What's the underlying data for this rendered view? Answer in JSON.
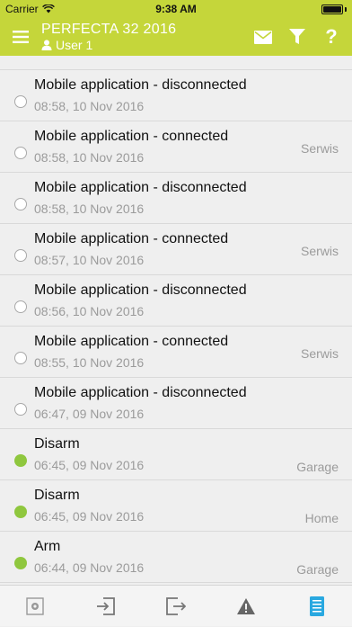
{
  "status_bar": {
    "carrier": "Carrier",
    "time": "9:38 AM"
  },
  "header": {
    "title": "PERFECTA 32 2016",
    "user": "User 1",
    "icons": {
      "menu": "menu-icon",
      "mail": "mail-icon",
      "filter": "filter-icon",
      "help": "help-icon"
    },
    "help_glyph": "?"
  },
  "colors": {
    "brand": "#c5d63a",
    "active_dot": "#8fc73e",
    "inactive_dot": "#ffffff",
    "tab_active": "#29a8e0"
  },
  "events": [
    {
      "title": "Mobile application - disconnected",
      "date": "08:58, 10 Nov 2016",
      "tag": "",
      "active": false
    },
    {
      "title": "Mobile application - connected",
      "date": "08:58, 10 Nov 2016",
      "tag": "Serwis",
      "active": false
    },
    {
      "title": "Mobile application - disconnected",
      "date": "08:58, 10 Nov 2016",
      "tag": "",
      "active": false
    },
    {
      "title": "Mobile application - connected",
      "date": "08:57, 10 Nov 2016",
      "tag": "Serwis",
      "active": false
    },
    {
      "title": "Mobile application - disconnected",
      "date": "08:56, 10 Nov 2016",
      "tag": "",
      "active": false
    },
    {
      "title": "Mobile application - connected",
      "date": "08:55, 10 Nov 2016",
      "tag": "Serwis",
      "active": false
    },
    {
      "title": "Mobile application - disconnected",
      "date": "06:47, 09 Nov 2016",
      "tag": "",
      "active": false
    },
    {
      "title": "Disarm",
      "date": "06:45, 09 Nov 2016",
      "tag": "Garage",
      "active": true
    },
    {
      "title": "Disarm",
      "date": "06:45, 09 Nov 2016",
      "tag": "Home",
      "active": true
    },
    {
      "title": "Arm",
      "date": "06:44, 09 Nov 2016",
      "tag": "Garage",
      "active": true
    }
  ],
  "tabs": [
    {
      "name": "keypad-tab",
      "icon": "keypad-icon",
      "active": false
    },
    {
      "name": "inputs-tab",
      "icon": "login-icon",
      "active": false
    },
    {
      "name": "outputs-tab",
      "icon": "logout-icon",
      "active": false
    },
    {
      "name": "troubles-tab",
      "icon": "warning-icon",
      "active": false
    },
    {
      "name": "events-tab",
      "icon": "event-log-icon",
      "active": true
    }
  ],
  "tab_glyphs": {
    "warning": "!"
  }
}
